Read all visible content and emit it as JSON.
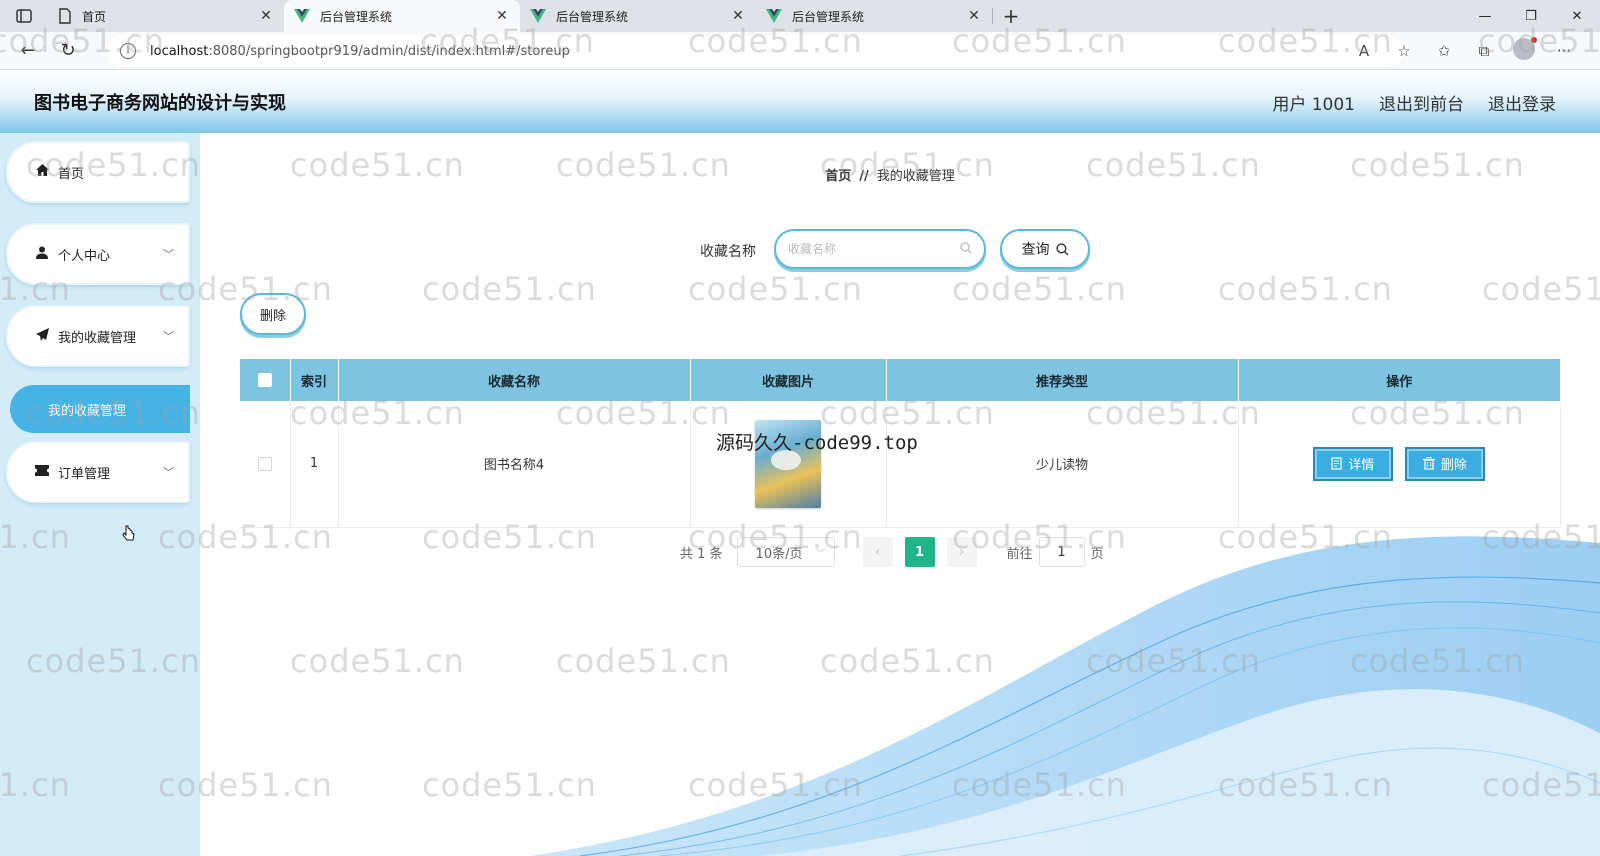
{
  "browser": {
    "tabs": [
      {
        "title": "首页",
        "icon": "page-icon",
        "active": false
      },
      {
        "title": "后台管理系统",
        "icon": "vue-logo-icon",
        "active": true
      },
      {
        "title": "后台管理系统",
        "icon": "vue-logo-icon",
        "active": false
      },
      {
        "title": "后台管理系统",
        "icon": "vue-logo-icon",
        "active": false
      }
    ],
    "url_host": "localhost",
    "url_rest": ":8080/springbootpr919/admin/dist/index.html#/storeup"
  },
  "header": {
    "title": "图书电子商务网站的设计与实现",
    "user": "用户 1001",
    "to_front": "退出到前台",
    "logout": "退出登录"
  },
  "sidebar": {
    "items": [
      {
        "label": "首页",
        "icon": "home-icon"
      },
      {
        "label": "个人中心",
        "icon": "user-icon"
      },
      {
        "label": "我的收藏管理",
        "icon": "send-icon"
      },
      {
        "label": "订单管理",
        "icon": "ticket-icon"
      }
    ],
    "sub_item": "我的收藏管理"
  },
  "breadcrumb": {
    "home": "首页",
    "sep": "//",
    "current": "我的收藏管理"
  },
  "search": {
    "label": "收藏名称",
    "placeholder": "收藏名称",
    "value": "",
    "button": "查询"
  },
  "toolbar": {
    "delete_label": "删除"
  },
  "table": {
    "columns": [
      "索引",
      "收藏名称",
      "收藏图片",
      "推荐类型",
      "操作"
    ],
    "rows": [
      {
        "index": "1",
        "name": "图书名称4",
        "type": "少儿读物",
        "detail_label": "详情",
        "delete_label": "删除"
      }
    ]
  },
  "pagination": {
    "total": "共 1 条",
    "page_size": "10条/页",
    "current": "1",
    "goto": "前往",
    "goto_value": "1",
    "page_unit": "页"
  },
  "watermark": {
    "text": "code51.cn",
    "overlay": "源码久久-code99.top"
  },
  "colors": {
    "accent": "#46b3e6",
    "table_header": "#7ec3df",
    "page_active": "#1fb48a"
  }
}
